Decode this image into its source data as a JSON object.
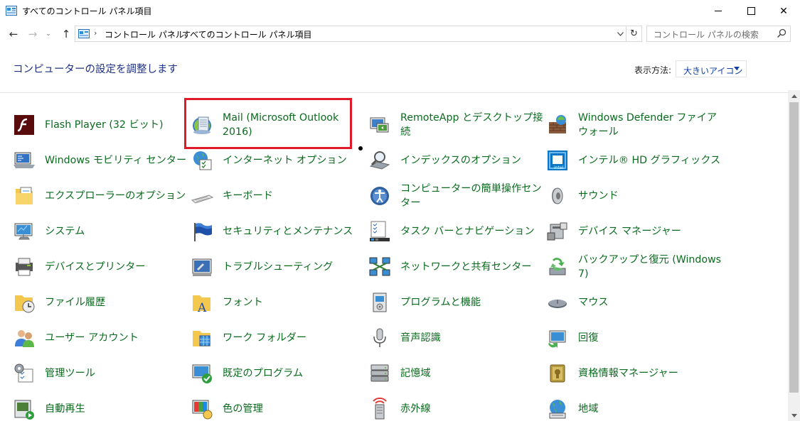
{
  "window": {
    "title": "すべてのコントロール パネル項目",
    "minimize_icon": "minimize-icon",
    "maximize_icon": "maximize-icon",
    "close_glyph": "✕"
  },
  "nav": {
    "back_glyph": "←",
    "forward_glyph": "→",
    "recent_glyph": "⌄",
    "up_glyph": "↑",
    "breadcrumbs": [
      "コントロール パネル",
      "すべてのコントロール パネル項目"
    ],
    "breadcrumb_sep": "›",
    "refresh_glyph": "↻",
    "search_placeholder": "コントロール パネルの検索"
  },
  "header": {
    "heading": "コンピューターの設定を調整します",
    "view_by_label": "表示方法:",
    "view_by_value": "大きいアイコン"
  },
  "items": [
    {
      "label": "Flash Player (32 ビット)",
      "icon": "flash-player-icon"
    },
    {
      "label": "Mail (Microsoft Outlook\n2016)",
      "icon": "mail-icon"
    },
    {
      "label": "RemoteApp とデスクトップ接\n続",
      "icon": "remoteapp-icon"
    },
    {
      "label": "Windows Defender ファイア\nウォール",
      "icon": "firewall-icon"
    },
    {
      "label": "Windows モビリティ センター",
      "icon": "mobility-center-icon"
    },
    {
      "label": "インターネット オプション",
      "icon": "internet-options-icon"
    },
    {
      "label": "インデックスのオプション",
      "icon": "indexing-options-icon"
    },
    {
      "label": "インテル® HD グラフィックス",
      "icon": "intel-graphics-icon"
    },
    {
      "label": "エクスプローラーのオプション",
      "icon": "explorer-options-icon"
    },
    {
      "label": "キーボード",
      "icon": "keyboard-icon"
    },
    {
      "label": "コンピューターの簡単操作セン\nター",
      "icon": "ease-of-access-icon"
    },
    {
      "label": "サウンド",
      "icon": "sound-icon"
    },
    {
      "label": "システム",
      "icon": "system-icon"
    },
    {
      "label": "セキュリティとメンテナンス",
      "icon": "security-maintenance-icon"
    },
    {
      "label": "タスク バーとナビゲーション",
      "icon": "taskbar-icon"
    },
    {
      "label": "デバイス マネージャー",
      "icon": "device-manager-icon"
    },
    {
      "label": "デバイスとプリンター",
      "icon": "devices-printers-icon"
    },
    {
      "label": "トラブルシューティング",
      "icon": "troubleshooting-icon"
    },
    {
      "label": "ネットワークと共有センター",
      "icon": "network-center-icon"
    },
    {
      "label": "バックアップと復元 (Windows\n7)",
      "icon": "backup-restore-icon"
    },
    {
      "label": "ファイル履歴",
      "icon": "file-history-icon"
    },
    {
      "label": "フォント",
      "icon": "fonts-icon"
    },
    {
      "label": "プログラムと機能",
      "icon": "programs-features-icon"
    },
    {
      "label": "マウス",
      "icon": "mouse-icon"
    },
    {
      "label": "ユーザー アカウント",
      "icon": "user-accounts-icon"
    },
    {
      "label": "ワーク フォルダー",
      "icon": "work-folders-icon"
    },
    {
      "label": "音声認識",
      "icon": "speech-recognition-icon"
    },
    {
      "label": "回復",
      "icon": "recovery-icon"
    },
    {
      "label": "管理ツール",
      "icon": "admin-tools-icon"
    },
    {
      "label": "既定のプログラム",
      "icon": "default-programs-icon"
    },
    {
      "label": "記憶域",
      "icon": "storage-spaces-icon"
    },
    {
      "label": "資格情報マネージャー",
      "icon": "credential-manager-icon"
    },
    {
      "label": "自動再生",
      "icon": "autoplay-icon"
    },
    {
      "label": "色の管理",
      "icon": "color-management-icon"
    },
    {
      "label": "赤外線",
      "icon": "infrared-icon"
    },
    {
      "label": "地域",
      "icon": "region-icon"
    }
  ],
  "colors": {
    "link_green": "#0a6b1e",
    "heading_blue": "#1e3287",
    "highlight_red": "#e01a28"
  }
}
